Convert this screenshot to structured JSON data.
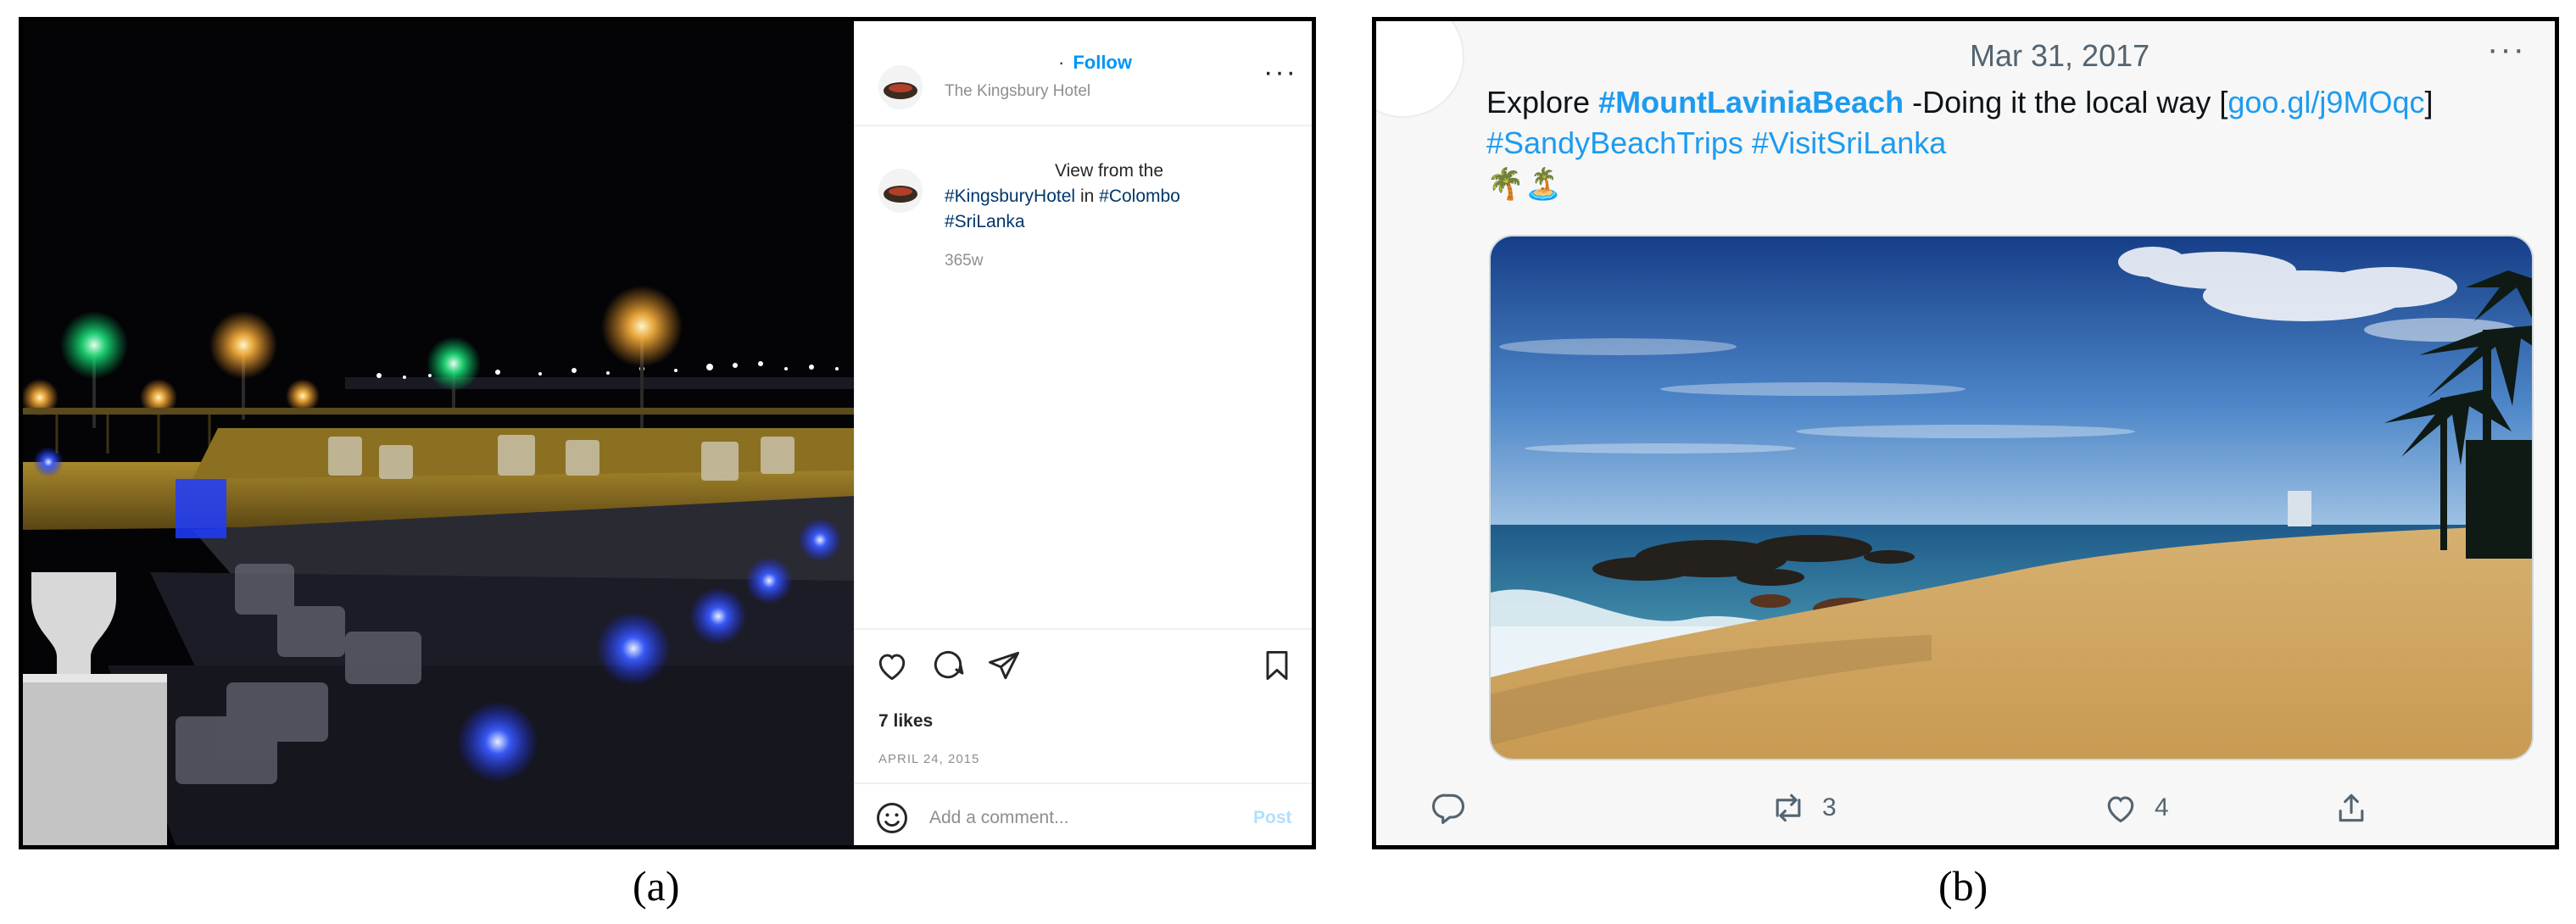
{
  "panel_a": {
    "label": "(a)",
    "header": {
      "follow_dot": "·",
      "follow_label": "Follow",
      "location": "The Kingsbury Hotel",
      "more_icon": "more-horizontal-icon"
    },
    "caption": {
      "text_lead": "View from the",
      "tag_hotel": "#KingsburyHotel",
      "word_in": "in",
      "tag_city": "#Colombo",
      "tag_country": "#SriLanka",
      "age": "365w"
    },
    "actions": {
      "like_icon": "heart-icon",
      "comment_icon": "comment-icon",
      "share_icon": "paper-plane-icon",
      "save_icon": "bookmark-icon"
    },
    "likes": "7 likes",
    "date": "APRIL 24, 2015",
    "comment": {
      "emoji_icon": "smiley-icon",
      "placeholder": "Add a comment...",
      "post_label": "Post"
    },
    "colors": {
      "link": "#00376b",
      "follow": "#0095f6",
      "post_disabled": "#b2dffc"
    }
  },
  "panel_b": {
    "label": "(b)",
    "date": "Mar 31, 2017",
    "more_icon": "more-horizontal-icon",
    "text": {
      "explore": "Explore",
      "tag_main": "#MountLaviniaBeach",
      "rest": "-Doing it the local way [",
      "link": "goo.gl/j9MOqc",
      "close": "]",
      "tag_trips": "#SandyBeachTrips",
      "tag_visit": "#VisitSriLanka",
      "emoji": "🌴🏝️"
    },
    "actions": {
      "reply_icon": "reply-icon",
      "retweet_icon": "retweet-icon",
      "retweet_count": "3",
      "like_icon": "heart-icon",
      "like_count": "4",
      "share_icon": "share-icon"
    },
    "colors": {
      "link": "#1d9bf0",
      "meta": "#536471"
    }
  }
}
